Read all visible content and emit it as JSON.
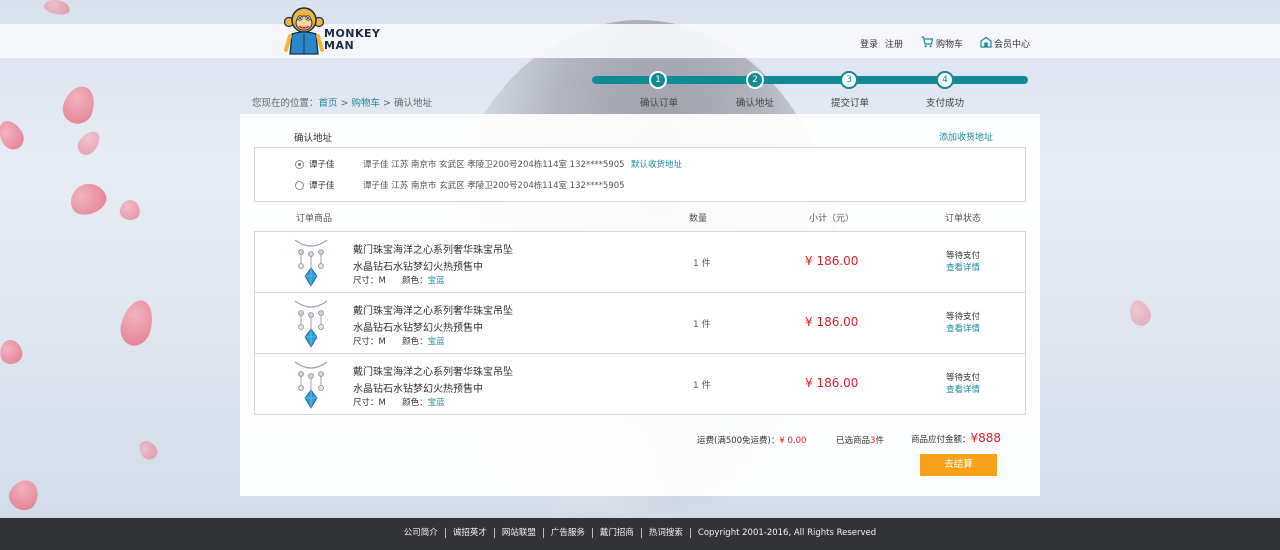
{
  "brand": {
    "line1": "MONKEY",
    "line2": "MAN"
  },
  "topnav": {
    "login": "登录",
    "register": "注册",
    "cart": "购物车",
    "member": "会员中心"
  },
  "breadcrumb": {
    "prefix": "您现在的位置：",
    "home": "首页",
    "cart": "购物车",
    "current": "确认地址",
    "separator": ">"
  },
  "steps": [
    {
      "num": "1",
      "label": "确认订单",
      "done": true
    },
    {
      "num": "2",
      "label": "确认地址",
      "done": true
    },
    {
      "num": "3",
      "label": "提交订单",
      "done": false
    },
    {
      "num": "4",
      "label": "支付成功",
      "done": false
    }
  ],
  "address": {
    "title": "确认地址",
    "add_link": "添加收货地址",
    "items": [
      {
        "name": "谭子佳",
        "detail": "谭子佳    江苏   南京市  玄武区  孝陵卫200号204栋114室     132****5905",
        "default_label": "默认收货地址",
        "checked": true
      },
      {
        "name": "谭子佳",
        "detail": "谭子佳    江苏   南京市  玄武区  孝陵卫200号204栋114室     132****5905",
        "default_label": "",
        "checked": false
      }
    ]
  },
  "table": {
    "headers": {
      "product": "订单商品",
      "qty": "数量",
      "subtotal": "小计（元）",
      "status": "订单状态"
    }
  },
  "orders": [
    {
      "title1": "戴门珠宝海洋之心系列奢华珠宝吊坠",
      "title2": "水晶钻石水钻梦幻火热预售中",
      "size_label": "尺寸：",
      "size": "M",
      "color_label": "颜色：",
      "color": "宝蓝",
      "qty": "1 件",
      "price": "¥ 186.00",
      "status": "等待支付",
      "detail_link": "查看详情"
    },
    {
      "title1": "戴门珠宝海洋之心系列奢华珠宝吊坠",
      "title2": "水晶钻石水钻梦幻火热预售中",
      "size_label": "尺寸：",
      "size": "M",
      "color_label": "颜色：",
      "color": "宝蓝",
      "qty": "1 件",
      "price": "¥ 186.00",
      "status": "等待支付",
      "detail_link": "查看详情"
    },
    {
      "title1": "戴门珠宝海洋之心系列奢华珠宝吊坠",
      "title2": "水晶钻石水钻梦幻火热预售中",
      "size_label": "尺寸：",
      "size": "M",
      "color_label": "颜色：",
      "color": "宝蓝",
      "qty": "1 件",
      "price": "¥ 186.00",
      "status": "等待支付",
      "detail_link": "查看详情"
    }
  ],
  "summary": {
    "shipping_label": "运费(满500免运费)：",
    "shipping_value": "¥ 0.00",
    "selected_prefix": "已选商品",
    "selected_count": "3",
    "selected_suffix": "件",
    "total_label": "商品应付金额：",
    "total_value": "¥888",
    "checkout": "去结算"
  },
  "footer": {
    "links": [
      "公司简介",
      "诚招英才",
      "网站联盟",
      "广告服务",
      "戴门招商",
      "热词搜索"
    ],
    "copyright": "Copyright    2001-2016, All Rights Reserved"
  },
  "colors": {
    "accent": "#0f8a96",
    "price": "#d9202a",
    "checkout": "#f9a11b",
    "footer_bg": "#333438"
  }
}
